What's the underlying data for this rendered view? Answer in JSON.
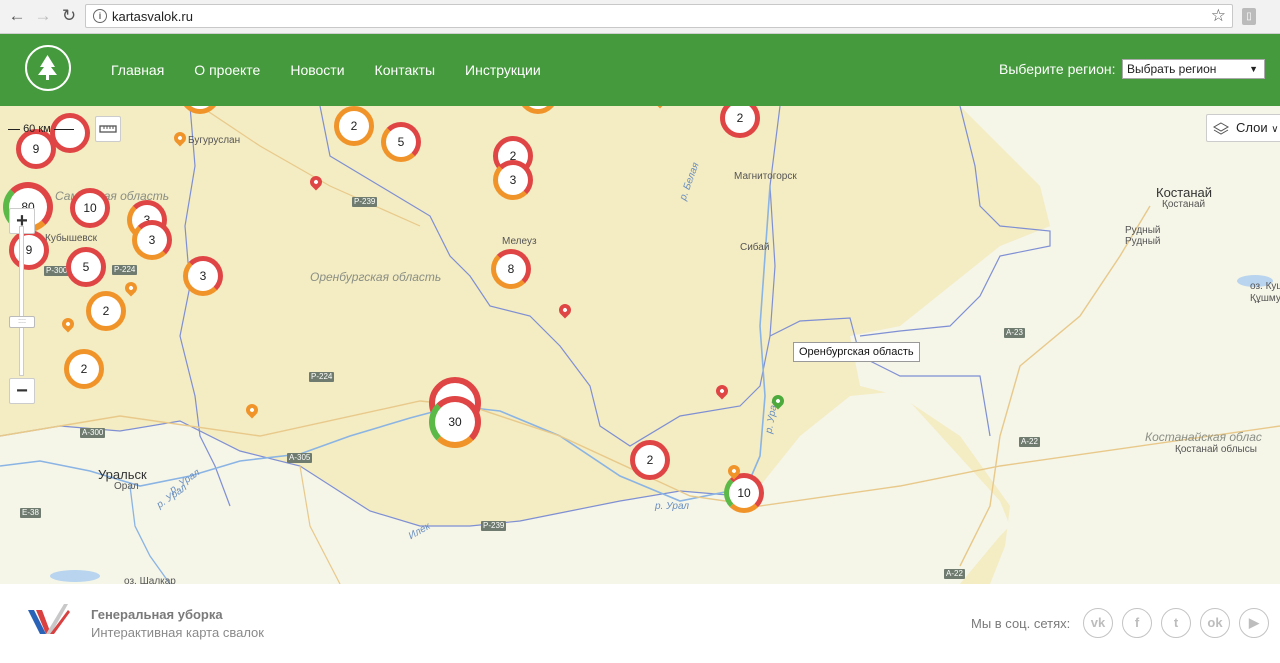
{
  "browser": {
    "url": "kartasvalok.ru"
  },
  "header": {
    "menu": [
      "Главная",
      "О проекте",
      "Новости",
      "Контакты",
      "Инструкции"
    ],
    "region_label": "Выберите регион:",
    "region_selected": "Выбрать регион"
  },
  "map": {
    "scale": "60 км",
    "layers_label": "Слои",
    "tooltip": "Оренбургская область",
    "region_names": {
      "orenburg": "Оренбургская область",
      "samara": "Самарская область",
      "kostanay": "Костанайская облас",
      "kostanay_kz": "Қостанай облысы"
    },
    "cities": {
      "kostanay": "Костанай",
      "kostanay_kz": "Қостанай",
      "rudny": "Рудный",
      "rudny_kz": "Рудный",
      "uralsk": "Уральск",
      "oral": "Орал",
      "buguruslan": "Бугуруслан",
      "magnitogorsk": "Магнитогорск",
      "meleuz": "Мелеуз",
      "sibay": "Сибай",
      "kuybyshevsk": "Кубышевск",
      "ozero_kushm": "оз. Куш",
      "ozero_kushm_kz": "Құшму",
      "ozero_shalkar": "оз. Шалкар"
    },
    "rivers": {
      "ural1": "р. Урал",
      "ural2": "р. Урал",
      "ural3": "р. Урал",
      "ural4": "р. Урал",
      "belaya": "р. Белая",
      "ilek": "Илек"
    },
    "roads": [
      "Р-239",
      "Р-224",
      "Р-300",
      "Р-224",
      "А-300",
      "А-305",
      "А-23",
      "А-22",
      "Е-38",
      "Р-239",
      "А-22"
    ],
    "clusters": [
      "9",
      "80",
      "9",
      "10",
      "3",
      "3",
      "5",
      "3",
      "2",
      "2",
      "2",
      "5",
      "2",
      "3",
      "2",
      "8",
      "30",
      "2",
      "10"
    ]
  },
  "footer": {
    "title": "Генеральная уборка",
    "subtitle": "Интерактивная карта свалок",
    "social_label": "Мы в соц. сетях:",
    "social": [
      "vk-icon",
      "facebook-icon",
      "twitter-icon",
      "odnoklassniki-icon",
      "youtube-icon"
    ],
    "social_glyphs": [
      "vk",
      "f",
      "t",
      "ok",
      "▶"
    ]
  },
  "colors": {
    "header_green": "#449a3c",
    "cluster_red": "#e04545",
    "cluster_orange": "#f0942a",
    "cluster_green": "#5ab947",
    "map_land": "#f4ecc2",
    "map_kz": "#f5f5e8"
  }
}
